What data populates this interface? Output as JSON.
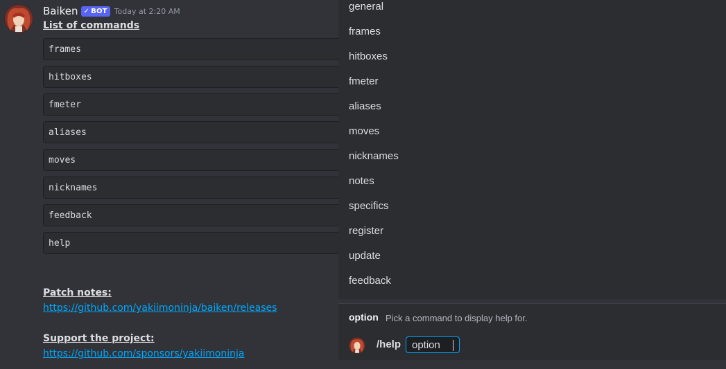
{
  "message": {
    "username": "Baiken",
    "bot_badge": "BOT",
    "timestamp": "Today at 2:20 AM",
    "list_title": "List of commands",
    "commands": [
      "frames",
      "hitboxes",
      "fmeter",
      "aliases",
      "moves",
      "nicknames",
      "feedback",
      "help"
    ],
    "patch_notes_title": "Patch notes:",
    "patch_notes_link": "https://github.com/yakiimoninja/baiken/releases",
    "support_title": "Support the project:",
    "support_link": "https://github.com/sponsors/yakiimoninja"
  },
  "autocomplete": {
    "items": [
      "general",
      "frames",
      "hitboxes",
      "fmeter",
      "aliases",
      "moves",
      "nicknames",
      "notes",
      "specifics",
      "register",
      "update",
      "feedback"
    ]
  },
  "option_hint": {
    "name": "option",
    "description": "Pick a command to display help for."
  },
  "command_input": {
    "command": "/help",
    "option_label": "option"
  },
  "colors": {
    "background": "#313338",
    "popup": "#2b2d31",
    "link": "#00a8fc",
    "bot_badge": "#5865f2"
  }
}
